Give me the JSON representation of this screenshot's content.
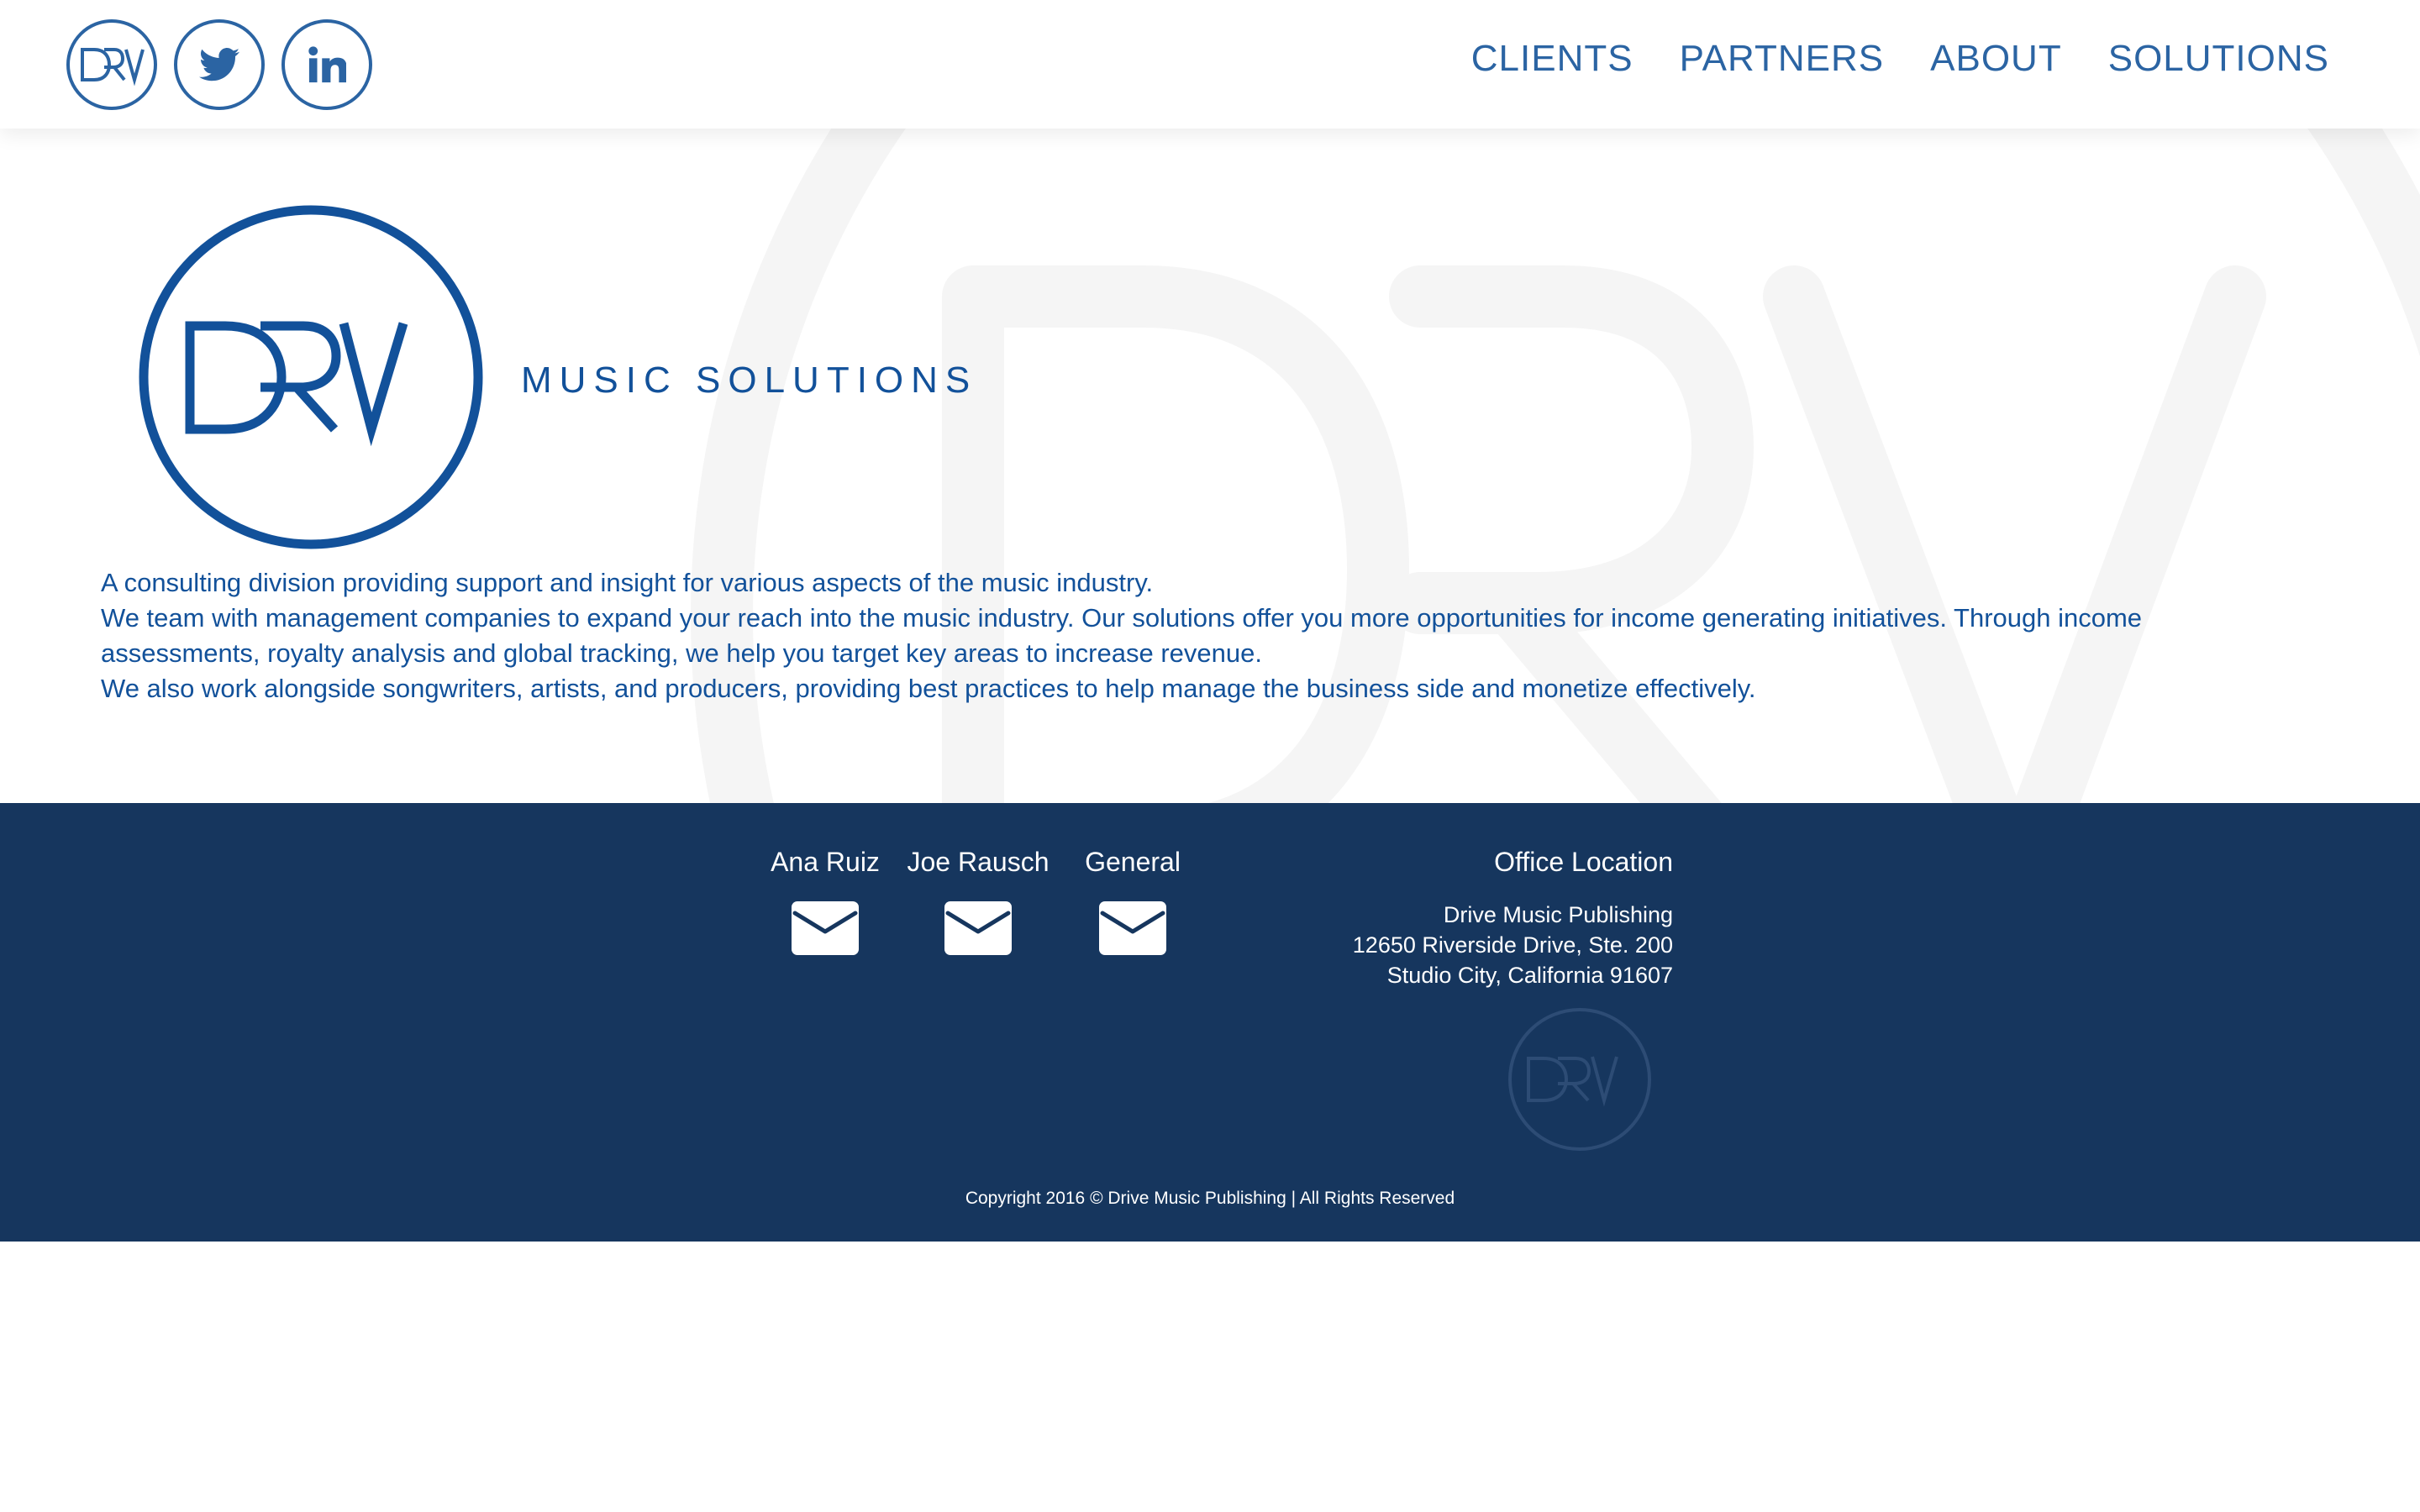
{
  "header": {
    "social": [
      {
        "icon": "drv-logo-icon"
      },
      {
        "icon": "twitter-icon"
      },
      {
        "icon": "linkedin-icon"
      }
    ],
    "nav": [
      {
        "label": "CLIENTS"
      },
      {
        "label": "PARTNERS"
      },
      {
        "label": "ABOUT"
      },
      {
        "label": "SOLUTIONS"
      }
    ]
  },
  "hero": {
    "logo_text": "DRV",
    "tagline": "MUSIC SOLUTIONS",
    "paragraphs": [
      "A consulting division providing support and insight for various aspects of the music industry.",
      "We team with management companies to expand your reach into the music industry. Our solutions offer you more opportunities for income generating initiatives. Through income assessments, royalty analysis and global tracking, we help you target key areas to increase revenue.",
      "We also work alongside songwriters, artists, and producers, providing best practices to help manage the business side and monetize effectively."
    ]
  },
  "footer": {
    "contacts": [
      {
        "name": "Ana Ruiz",
        "icon": "envelope-icon"
      },
      {
        "name": "Joe Rausch",
        "icon": "envelope-icon"
      },
      {
        "name": "General",
        "icon": "envelope-icon"
      }
    ],
    "office": {
      "title": "Office Location",
      "lines": [
        "Drive Music Publishing",
        "12650 Riverside Drive, Ste. 200",
        "Studio City, California 91607"
      ]
    },
    "copyright": "Copyright 2016 © Drive Music Publishing | All Rights Reserved"
  },
  "colors": {
    "brand_blue": "#12519a",
    "nav_blue": "#2b64a3",
    "footer_navy": "#16365e",
    "watermark_gray": "#f5f5f5"
  }
}
